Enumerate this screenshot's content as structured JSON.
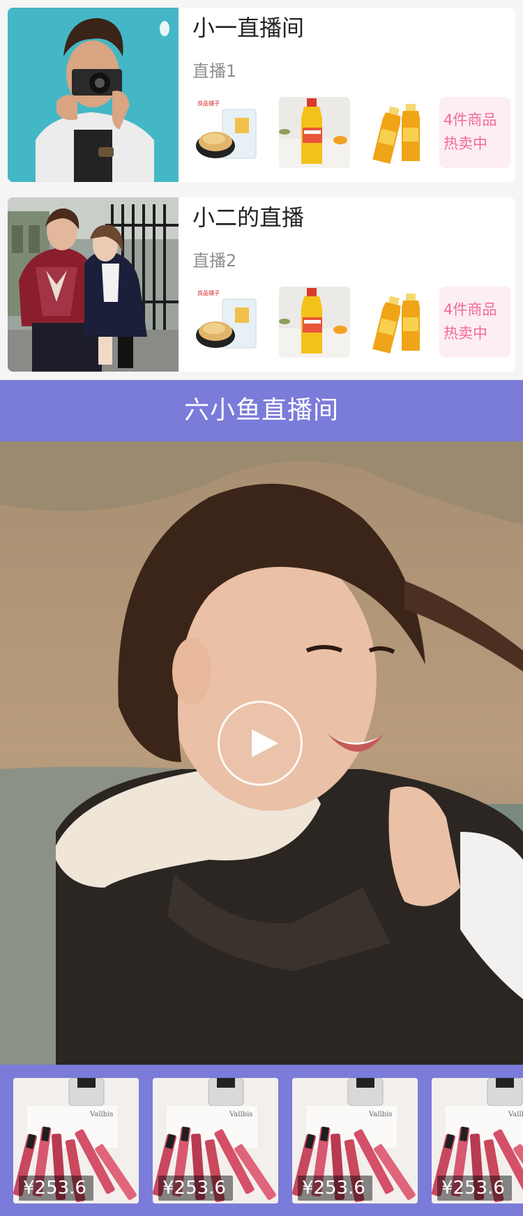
{
  "rooms": [
    {
      "title": "小一直播间",
      "subtitle": "直播1",
      "more_line1": "4件商品",
      "more_line2": "热卖中",
      "cover_icon": "photographer-photo",
      "products": [
        "dried-snack-icon",
        "cooking-oil-icon",
        "juice-bottles-icon"
      ]
    },
    {
      "title": "小二的直播",
      "subtitle": "直播2",
      "more_line1": "4件商品",
      "more_line2": "热卖中",
      "cover_icon": "couple-photo",
      "products": [
        "dried-snack-icon",
        "cooking-oil-icon",
        "juice-bottles-icon"
      ]
    }
  ],
  "live": {
    "title": "六小鱼直播间",
    "play_icon": "play-icon"
  },
  "products": [
    {
      "price": "¥253.6",
      "icon": "lipstick-set-icon"
    },
    {
      "price": "¥253.6",
      "icon": "lipstick-set-icon"
    },
    {
      "price": "¥253.6",
      "icon": "lipstick-set-icon"
    },
    {
      "price": "¥253.6",
      "icon": "lipstick-set-icon"
    }
  ],
  "colors": {
    "accent": "#7b7bda",
    "hot_text": "#f26a94",
    "hot_bg": "#fdeef2",
    "page_bg": "#f5f5f5"
  }
}
